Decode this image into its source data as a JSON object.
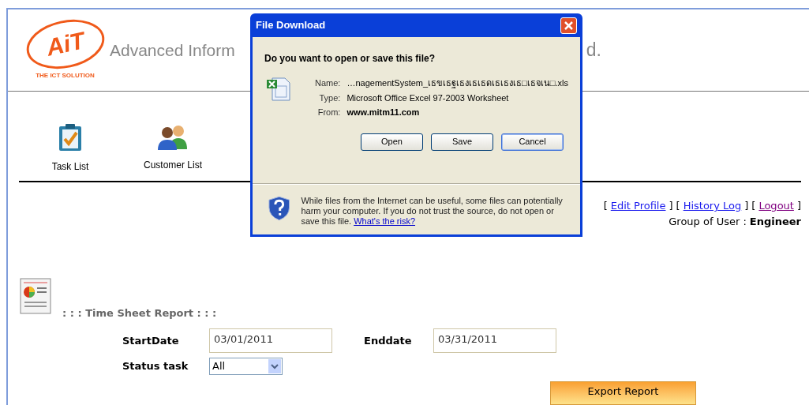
{
  "header": {
    "logo_text": "AiT",
    "logo_tagline": "THE ICT SOLUTION",
    "title_left": "Advanced Inform",
    "title_right": "d."
  },
  "nav": [
    {
      "kind": "task",
      "label": "Task List"
    },
    {
      "kind": "customer",
      "label": "Customer List"
    }
  ],
  "user_links": [
    {
      "open": "[",
      "label": "Edit Profile",
      "close": "]",
      "visited": false
    },
    {
      "open": "[",
      "label": "History Log",
      "close": "]",
      "visited": false
    },
    {
      "open": "[",
      "label": "Logout",
      "close": "]",
      "visited": true
    }
  ],
  "user_group": {
    "label": "Group of User :",
    "value": "Engineer"
  },
  "report": {
    "title": ": : : Time Sheet Report : : :",
    "start_label": "StartDate",
    "start_value": "03/01/2011",
    "end_label": "Enddate",
    "end_value": "03/31/2011",
    "status_label": "Status task",
    "status_value": "All",
    "export_button": "Export Report"
  },
  "dialog": {
    "title": "File Download",
    "question": "Do you want to open or save this file?",
    "fields": [
      {
        "label": "Name:",
        "value": "…nagementSystem_เธขเธฐเธงเธเธดเธเธงเธ□เธจเน□.xls",
        "bold": false
      },
      {
        "label": "Type:",
        "value": "Microsoft Office Excel 97-2003 Worksheet",
        "bold": false
      },
      {
        "label": "From:",
        "value": "www.mitm11.com",
        "bold": true
      }
    ],
    "buttons": [
      {
        "label": "Open",
        "default": false
      },
      {
        "label": "Save",
        "default": false
      },
      {
        "label": "Cancel",
        "default": true
      }
    ],
    "warning": "While files from the Internet can be useful, some files can potentially harm your computer. If you do not trust the source, do not open or save this file.",
    "risk_link": "What's the risk?"
  }
}
